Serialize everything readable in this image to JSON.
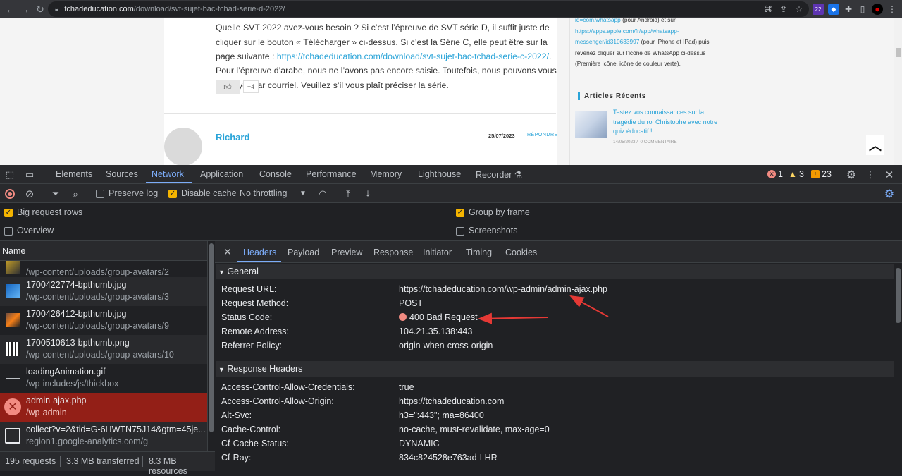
{
  "browser": {
    "url_host": "tchadeducation.com",
    "url_path": "/download/svt-sujet-bac-tchad-serie-d-2022/",
    "extension_badge": "22"
  },
  "page": {
    "para1": "Quelle SVT 2022 avez-vous besoin ? Si c’est l’épreuve de SVT série D, il suffit juste de cliquer sur le bouton « Télécharger » ci-dessus. Si c’est la Série C, elle peut être sur la page suivante :",
    "para1_link": "https://tchadeducation.com/download/svt-sujet-bac-tchad-serie-c-2022/",
    "para2": "Pour l’épreuve d’arabe, nous ne l’avons pas encore saisie. Toutefois, nous pouvons vous l’envoyer par courriel. Veuillez s’il vous plaît préciser la série.",
    "like_count": "+4",
    "comment_author": "Richard",
    "comment_date": "25/07/2023",
    "reply_label": "RÉPONDRE",
    "sidebar_line1_link": "id=com.whatsapp",
    "sidebar_line1_text": " (pour Android) et sur",
    "sidebar_link2": "https://apps.apple.com/fr/app/whatsapp-messenger/id310633997",
    "sidebar_text2": " (pour IPhone et IPad) puis revenez cliquer sur l’icône de WhatsApp ci-dessus (Première icône, icône de couleur verte).",
    "recent_title": "Articles Récents",
    "post_title": "Testez vos connaissances sur la tragédie du roi Christophe avec notre quiz éducatif !",
    "post_date": "14/05/2023",
    "post_comments": "0 COMMENTAIRE"
  },
  "devtools": {
    "tabs": [
      "Elements",
      "Sources",
      "Network",
      "Application",
      "Console",
      "Performance",
      "Memory",
      "Lighthouse",
      "Recorder"
    ],
    "active_tab": "Network",
    "errors": "1",
    "warnings": "3",
    "issues": "23",
    "toolbar": {
      "preserve_log": "Preserve log",
      "disable_cache": "Disable cache",
      "throttling": "No throttling"
    },
    "settings": {
      "big_rows": "Big request rows",
      "overview": "Overview",
      "group_by_frame": "Group by frame",
      "screenshots": "Screenshots"
    },
    "list_header": "Name",
    "requests": [
      {
        "name": "",
        "path": "/wp-content/uploads/group-avatars/2"
      },
      {
        "name": "1700422774-bpthumb.jpg",
        "path": "/wp-content/uploads/group-avatars/3"
      },
      {
        "name": "1700426412-bpthumb.jpg",
        "path": "/wp-content/uploads/group-avatars/9"
      },
      {
        "name": "1700510613-bpthumb.png",
        "path": "/wp-content/uploads/group-avatars/10"
      },
      {
        "name": "loadingAnimation.gif",
        "path": "/wp-includes/js/thickbox"
      },
      {
        "name": "admin-ajax.php",
        "path": "/wp-admin"
      },
      {
        "name": "collect?v=2&tid=G-6HWTN75J14&gtm=45je...",
        "path": "region1.google-analytics.com/g"
      }
    ],
    "status_bar": {
      "requests": "195 requests",
      "transferred": "3.3 MB transferred",
      "resources": "8.3 MB resources"
    },
    "detail_tabs": [
      "Headers",
      "Payload",
      "Preview",
      "Response",
      "Initiator",
      "Timing",
      "Cookies"
    ],
    "general_title": "General",
    "general": [
      {
        "k": "Request URL:",
        "v": "https://tchadeducation.com/wp-admin/admin-ajax.php"
      },
      {
        "k": "Request Method:",
        "v": "POST"
      },
      {
        "k": "Status Code:",
        "v": "400 Bad Request"
      },
      {
        "k": "Remote Address:",
        "v": "104.21.35.138:443"
      },
      {
        "k": "Referrer Policy:",
        "v": "origin-when-cross-origin"
      }
    ],
    "response_title": "Response Headers",
    "response": [
      {
        "k": "Access-Control-Allow-Credentials:",
        "v": "true"
      },
      {
        "k": "Access-Control-Allow-Origin:",
        "v": "https://tchadeducation.com"
      },
      {
        "k": "Alt-Svc:",
        "v": "h3=\":443\"; ma=86400"
      },
      {
        "k": "Cache-Control:",
        "v": "no-cache, must-revalidate, max-age=0"
      },
      {
        "k": "Cf-Cache-Status:",
        "v": "DYNAMIC"
      },
      {
        "k": "Cf-Ray:",
        "v": "834c824528e763ad-LHR"
      }
    ],
    "colors": {
      "error": "#f28b82",
      "accent": "#7cacf8",
      "selected_row": "#931f17",
      "annotation": "#e53935"
    }
  }
}
